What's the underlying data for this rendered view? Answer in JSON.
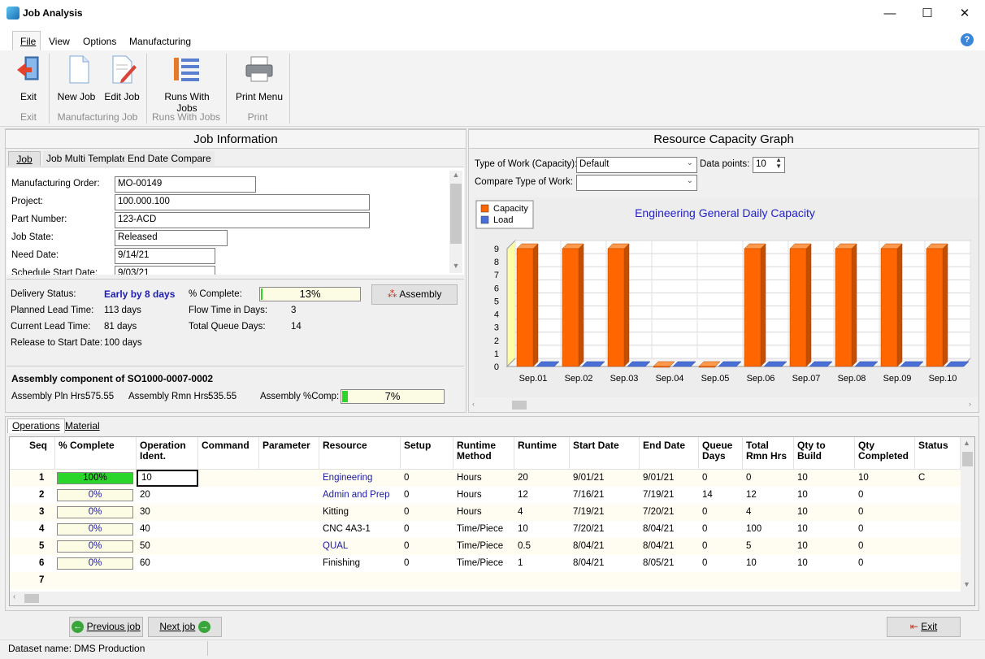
{
  "window": {
    "title": "Job Analysis",
    "minimize": "—",
    "maximize": "☐",
    "close": "✕"
  },
  "menu": {
    "file": "File",
    "view": "View",
    "options": "Options",
    "manufacturing": "Manufacturing",
    "help_icon": "?"
  },
  "ribbon": {
    "exit_label": "Exit",
    "new_job_label": "New Job",
    "edit_job_label": "Edit Job",
    "runs_with_jobs_label": "Runs With Jobs",
    "print_menu_label": "Print Menu",
    "groups": {
      "exit": "Exit",
      "manufacturing_job": "Manufacturing Job",
      "runs_with_jobs": "Runs With Jobs",
      "print": "Print"
    }
  },
  "job_info": {
    "title": "Job Information",
    "tabs": [
      "Job",
      "Job Multi Template",
      "End Date Compare"
    ],
    "fields": {
      "mo_label": "Manufacturing Order:",
      "mo_value": "MO-00149",
      "project_label": "Project:",
      "project_value": "100.000.100",
      "part_label": "Part Number:",
      "part_value": "123-ACD",
      "state_label": "Job State:",
      "state_value": "Released",
      "need_label": "Need Date:",
      "need_value": "9/14/21",
      "sched_label": "Schedule Start Date:",
      "sched_value": "9/03/21"
    },
    "delivery": {
      "status_label": "Delivery Status:",
      "status_value": "Early by 8 days",
      "pct_label": "% Complete:",
      "pct_value": "13%",
      "pct_number": 13,
      "assembly_button": "Assembly",
      "planned_label": "Planned Lead Time:",
      "planned_value": "113 days",
      "flow_label": "Flow Time in Days:",
      "flow_value": "3",
      "current_label": "Current Lead Time:",
      "current_value": "81 days",
      "queue_label": "Total Queue Days:",
      "queue_value": "14",
      "release_label": "Release to Start Date:",
      "release_value": "100 days"
    },
    "assembly": {
      "heading": "Assembly component of SO1000-0007-0002",
      "pln_label": "Assembly Pln Hrs:",
      "pln_value": "575.55",
      "rmn_label": "Assembly Rmn Hrs:",
      "rmn_value": "535.55",
      "comp_label": "Assembly %Comp:",
      "comp_value": "7%",
      "comp_number": 7
    }
  },
  "resource_graph": {
    "title": "Resource Capacity Graph",
    "type_label": "Type of Work (Capacity):",
    "type_value": "Default",
    "data_points_label": "Data points:",
    "data_points_value": "10",
    "compare_label": "Compare Type of Work:",
    "compare_value": ""
  },
  "chart_data": {
    "type": "bar",
    "title": "Engineering General Daily Capacity",
    "categories": [
      "Sep.01",
      "Sep.02",
      "Sep.03",
      "Sep.04",
      "Sep.05",
      "Sep.06",
      "Sep.07",
      "Sep.08",
      "Sep.09",
      "Sep.10"
    ],
    "series": [
      {
        "name": "Capacity",
        "color": "#ff6600",
        "values": [
          9,
          9,
          9,
          0,
          0,
          9,
          9,
          9,
          9,
          9
        ]
      },
      {
        "name": "Load",
        "color": "#4a6fd6",
        "values": [
          0,
          0,
          0,
          0,
          0,
          0,
          0,
          0,
          0,
          0
        ]
      }
    ],
    "ylim": [
      0,
      9
    ],
    "yticks": [
      "0",
      "1",
      "2",
      "3",
      "4",
      "5",
      "6",
      "7",
      "8",
      "9"
    ],
    "legend": "top-left",
    "grid": true
  },
  "operations": {
    "tabs": [
      "Operations",
      "Material"
    ],
    "columns": [
      "Seq",
      "% Complete",
      "Operation Ident.",
      "Command",
      "Parameter",
      "Resource",
      "Setup",
      "Runtime Method",
      "Runtime",
      "Start Date",
      "End Date",
      "Queue Days",
      "Total Rmn Hrs",
      "Qty to Build",
      "Qty Completed",
      "Status"
    ],
    "rows": [
      {
        "seq": "1",
        "pct": "100%",
        "pct_num": 100,
        "ident": "10",
        "command": "",
        "parameter": "",
        "resource": "Engineering",
        "setup": "0",
        "method": "Hours",
        "runtime": "20",
        "start": "9/01/21",
        "end": "9/01/21",
        "queue": "0",
        "rmn": "0",
        "qty": "10",
        "done": "10",
        "status": "C"
      },
      {
        "seq": "2",
        "pct": "0%",
        "pct_num": 0,
        "ident": "20",
        "command": "",
        "parameter": "",
        "resource": "Admin and Prep",
        "setup": "0",
        "method": "Hours",
        "runtime": "12",
        "start": "7/16/21",
        "end": "7/19/21",
        "queue": "14",
        "rmn": "12",
        "qty": "10",
        "done": "0",
        "status": ""
      },
      {
        "seq": "3",
        "pct": "0%",
        "pct_num": 0,
        "ident": "30",
        "command": "",
        "parameter": "",
        "resource": "Kitting",
        "setup": "0",
        "method": "Hours",
        "runtime": "4",
        "start": "7/19/21",
        "end": "7/20/21",
        "queue": "0",
        "rmn": "4",
        "qty": "10",
        "done": "0",
        "status": ""
      },
      {
        "seq": "4",
        "pct": "0%",
        "pct_num": 0,
        "ident": "40",
        "command": "",
        "parameter": "",
        "resource": "CNC 4A3-1",
        "setup": "0",
        "method": "Time/Piece",
        "runtime": "10",
        "start": "7/20/21",
        "end": "8/04/21",
        "queue": "0",
        "rmn": "100",
        "qty": "10",
        "done": "0",
        "status": ""
      },
      {
        "seq": "5",
        "pct": "0%",
        "pct_num": 0,
        "ident": "50",
        "command": "",
        "parameter": "",
        "resource": "QUAL",
        "setup": "0",
        "method": "Time/Piece",
        "runtime": "0.5",
        "start": "8/04/21",
        "end": "8/04/21",
        "queue": "0",
        "rmn": "5",
        "qty": "10",
        "done": "0",
        "status": ""
      },
      {
        "seq": "6",
        "pct": "0%",
        "pct_num": 0,
        "ident": "60",
        "command": "",
        "parameter": "",
        "resource": "Finishing",
        "setup": "0",
        "method": "Time/Piece",
        "runtime": "1",
        "start": "8/04/21",
        "end": "8/05/21",
        "queue": "0",
        "rmn": "10",
        "qty": "10",
        "done": "0",
        "status": ""
      },
      {
        "seq": "7",
        "pct": "",
        "pct_num": null,
        "ident": "",
        "command": "",
        "parameter": "",
        "resource": "",
        "setup": "",
        "method": "",
        "runtime": "",
        "start": "",
        "end": "",
        "queue": "",
        "rmn": "",
        "qty": "",
        "done": "",
        "status": ""
      }
    ]
  },
  "footer": {
    "previous_job": "Previous job",
    "next_job": "Next job",
    "exit": "Exit"
  },
  "status": {
    "dataset_label": "Dataset name:",
    "dataset_value": "DMS Production"
  }
}
